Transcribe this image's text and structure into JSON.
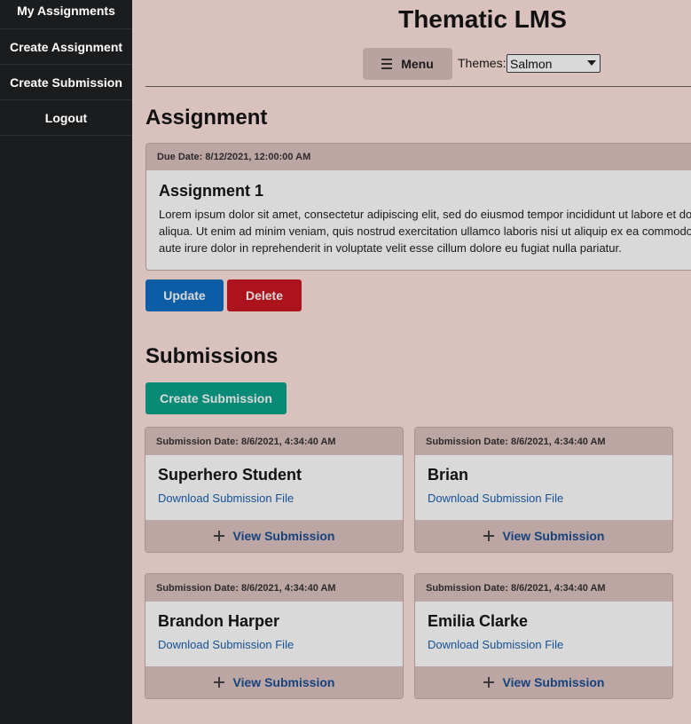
{
  "sidebar": {
    "items": [
      {
        "label": "My Assignments"
      },
      {
        "label": "Create Assignment"
      },
      {
        "label": "Create Submission"
      },
      {
        "label": "Logout"
      }
    ]
  },
  "header": {
    "title": "Thematic LMS",
    "menu_label": "Menu",
    "themes_label": "Themes:",
    "theme_selected": "Salmon"
  },
  "assignment": {
    "heading": "Assignment",
    "due_date": "Due Date: 8/12/2021, 12:00:00 AM",
    "title": "Assignment 1",
    "body_lines": [
      "Lorem ipsum dolor sit amet, consectetur adipiscing elit, sed do eiusmod tempor incididunt ut labore et dolore magna",
      "aliqua. Ut enim ad minim veniam, quis nostrud exercitation ullamco laboris nisi ut aliquip ex ea commodo consequat. Duis",
      "aute irure dolor in reprehenderit in voluptate velit esse cillum dolore eu fugiat nulla pariatur."
    ],
    "update_label": "Update",
    "delete_label": "Delete"
  },
  "submissions": {
    "heading": "Submissions",
    "create_label": "Create Submission",
    "items": [
      {
        "date": "Submission Date: 8/6/2021, 4:34:40 AM",
        "name": "Superhero Student",
        "download": "Download Submission File",
        "view": "View Submission"
      },
      {
        "date": "Submission Date: 8/6/2021, 4:34:40 AM",
        "name": "Brian",
        "download": "Download Submission File",
        "view": "View Submission"
      },
      {
        "date": "Submission Date: 8/6/2021, 4:34:40 AM",
        "name": "Brandon Harper",
        "download": "Download Submission File",
        "view": "View Submission"
      },
      {
        "date": "Submission Date: 8/6/2021, 4:34:40 AM",
        "name": "Emilia Clarke",
        "download": "Download Submission File",
        "view": "View Submission"
      }
    ]
  },
  "colors": {
    "sidebar_bg": "#1b1c1e",
    "page_bg": "#ffe3df",
    "update_btn": "#0d6fc4",
    "delete_btn": "#cc1722",
    "create_btn": "#0aa38c",
    "link": "#1a61b0"
  }
}
